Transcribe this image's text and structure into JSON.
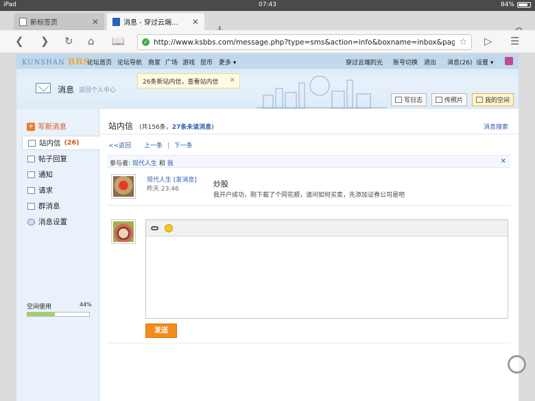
{
  "status_bar": {
    "device": "iPad",
    "time": "07:43",
    "battery": "84%"
  },
  "tabs": [
    {
      "label": "新标签页"
    },
    {
      "label": "消息 - 穿过云端..."
    }
  ],
  "browser": {
    "url": "http://www.ksbbs.com/message.php?type=sms&action=info&boxname=inbox&page..."
  },
  "site": {
    "logo_text": "KUNSHAN",
    "logo_bbs": "BBS",
    "nav_left": [
      "论坛首页",
      "论坛导航",
      "商家",
      "广场",
      "游戏",
      "昆币",
      "更多"
    ],
    "nav_right": [
      "穿过云端的光",
      "账号切换",
      "退出",
      "消息(26)",
      "设置"
    ],
    "header_title": "消息",
    "header_back": "返回个人中心",
    "notification": "26条新站内信，查看站内信",
    "header_buttons": [
      "写日志",
      "传照片",
      "我的空间"
    ]
  },
  "sidebar": {
    "compose": "写新消息",
    "items": [
      {
        "label": "站内信",
        "count": "(26)"
      },
      {
        "label": "帖子回复"
      },
      {
        "label": "通知"
      },
      {
        "label": "请求"
      },
      {
        "label": "群消息"
      },
      {
        "label": "消息设置"
      }
    ],
    "space_label": "空间使用",
    "space_percent_label": "44%",
    "space_fraction": 0.44
  },
  "main": {
    "title": "站内信",
    "total_prefix": "(共156条，",
    "unread": "27条未读消息",
    "total_suffix": ")",
    "search": "消息搜索",
    "back": "<<返回",
    "prev": "上一条",
    "next": "下一条",
    "participants_prefix": "参与者:",
    "participant_1": "现代人生",
    "participants_and": "和",
    "participant_2": "我",
    "message": {
      "sender": "现代人生 [发消息]",
      "time": "昨天 23:46",
      "subject": "炒股",
      "body": "我开户成功，刚下载了个同花顺，请问如何买卖，先添加证券公司是吧"
    },
    "send_button": "发送"
  }
}
